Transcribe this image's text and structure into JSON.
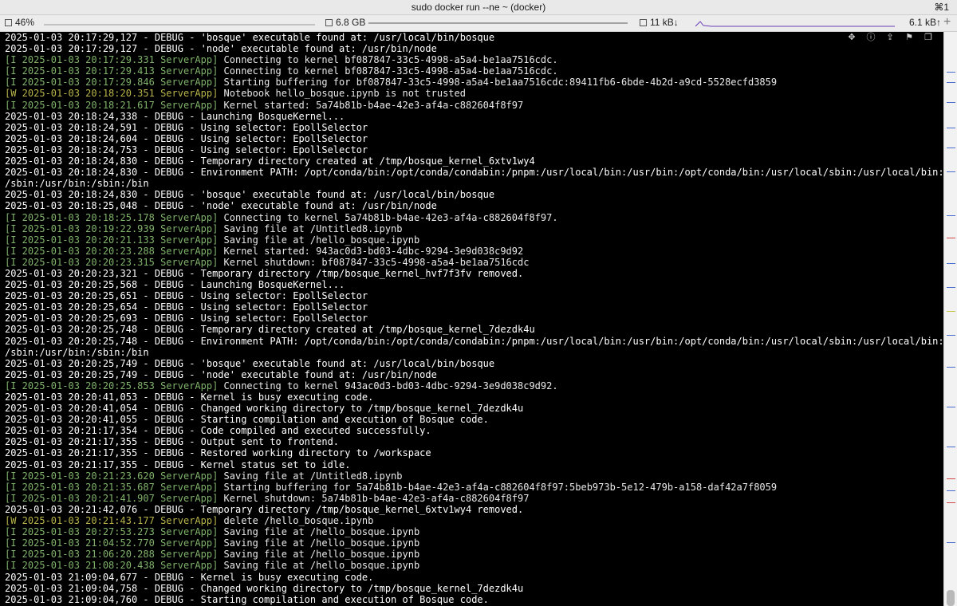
{
  "window": {
    "title": "sudo docker run --ne ~ (docker)",
    "shortcut": "⌘1"
  },
  "statusbar": {
    "cpu": "46%",
    "memory": "6.8 GB",
    "net_down": "11 kB↓",
    "net_up": "6.1 kB↑",
    "plus": "+"
  },
  "toolbar_icons": [
    "move-icon",
    "info-icon",
    "share-icon",
    "bookmark-icon",
    "copy-icon"
  ],
  "log_lines": [
    {
      "type": "debug",
      "text": "2025-01-03 20:17:29,127 - DEBUG - 'bosque' executable found at: /usr/local/bin/bosque"
    },
    {
      "type": "debug",
      "text": "2025-01-03 20:17:29,127 - DEBUG - 'node' executable found at: /usr/bin/node"
    },
    {
      "type": "info",
      "prefix": "[I 2025-01-03 20:17:29.331 ServerApp]",
      "text": " Connecting to kernel bf087847-33c5-4998-a5a4-be1aa7516cdc."
    },
    {
      "type": "info",
      "prefix": "[I 2025-01-03 20:17:29.413 ServerApp]",
      "text": " Connecting to kernel bf087847-33c5-4998-a5a4-be1aa7516cdc."
    },
    {
      "type": "info",
      "prefix": "[I 2025-01-03 20:17:29.846 ServerApp]",
      "text": " Starting buffering for bf087847-33c5-4998-a5a4-be1aa7516cdc:89411fb6-6bde-4b2d-a9cd-5528ecfd3859"
    },
    {
      "type": "warn",
      "prefix": "[W 2025-01-03 20:18:20.351 ServerApp]",
      "text": " Notebook hello_bosque.ipynb is not trusted"
    },
    {
      "type": "info",
      "prefix": "[I 2025-01-03 20:18:21.617 ServerApp]",
      "text": " Kernel started: 5a74b81b-b4ae-42e3-af4a-c882604f8f97"
    },
    {
      "type": "debug",
      "text": "2025-01-03 20:18:24,338 - DEBUG - Launching BosqueKernel..."
    },
    {
      "type": "debug",
      "text": "2025-01-03 20:18:24,591 - DEBUG - Using selector: EpollSelector"
    },
    {
      "type": "debug",
      "text": "2025-01-03 20:18:24,604 - DEBUG - Using selector: EpollSelector"
    },
    {
      "type": "debug",
      "text": "2025-01-03 20:18:24,753 - DEBUG - Using selector: EpollSelector"
    },
    {
      "type": "debug",
      "text": "2025-01-03 20:18:24,830 - DEBUG - Temporary directory created at /tmp/bosque_kernel_6xtv1wy4"
    },
    {
      "type": "debug",
      "text": "2025-01-03 20:18:24,830 - DEBUG - Environment PATH: /opt/conda/bin:/opt/conda/condabin:/pnpm:/usr/local/bin:/usr/bin:/opt/conda/bin:/usr/local/sbin:/usr/local/bin:/usr"
    },
    {
      "type": "debug",
      "text": "/sbin:/usr/bin:/sbin:/bin"
    },
    {
      "type": "debug",
      "text": "2025-01-03 20:18:24,830 - DEBUG - 'bosque' executable found at: /usr/local/bin/bosque"
    },
    {
      "type": "debug",
      "text": "2025-01-03 20:18:25,048 - DEBUG - 'node' executable found at: /usr/bin/node"
    },
    {
      "type": "info",
      "prefix": "[I 2025-01-03 20:18:25.178 ServerApp]",
      "text": " Connecting to kernel 5a74b81b-b4ae-42e3-af4a-c882604f8f97."
    },
    {
      "type": "info",
      "prefix": "[I 2025-01-03 20:19:22.939 ServerApp]",
      "text": " Saving file at /Untitled8.ipynb"
    },
    {
      "type": "info",
      "prefix": "[I 2025-01-03 20:20:21.133 ServerApp]",
      "text": " Saving file at /hello_bosque.ipynb"
    },
    {
      "type": "info",
      "prefix": "[I 2025-01-03 20:20:23.288 ServerApp]",
      "text": " Kernel started: 943ac0d3-bd03-4dbc-9294-3e9d038c9d92"
    },
    {
      "type": "info",
      "prefix": "[I 2025-01-03 20:20:23.315 ServerApp]",
      "text": " Kernel shutdown: bf087847-33c5-4998-a5a4-be1aa7516cdc"
    },
    {
      "type": "debug",
      "text": "2025-01-03 20:20:23,321 - DEBUG - Temporary directory /tmp/bosque_kernel_hvf7f3fv removed."
    },
    {
      "type": "debug",
      "text": "2025-01-03 20:20:25,568 - DEBUG - Launching BosqueKernel..."
    },
    {
      "type": "debug",
      "text": "2025-01-03 20:20:25,651 - DEBUG - Using selector: EpollSelector"
    },
    {
      "type": "debug",
      "text": "2025-01-03 20:20:25,654 - DEBUG - Using selector: EpollSelector"
    },
    {
      "type": "debug",
      "text": "2025-01-03 20:20:25,693 - DEBUG - Using selector: EpollSelector"
    },
    {
      "type": "debug",
      "text": "2025-01-03 20:20:25,748 - DEBUG - Temporary directory created at /tmp/bosque_kernel_7dezdk4u"
    },
    {
      "type": "debug",
      "text": "2025-01-03 20:20:25,748 - DEBUG - Environment PATH: /opt/conda/bin:/opt/conda/condabin:/pnpm:/usr/local/bin:/usr/bin:/opt/conda/bin:/usr/local/sbin:/usr/local/bin:/usr"
    },
    {
      "type": "debug",
      "text": "/sbin:/usr/bin:/sbin:/bin"
    },
    {
      "type": "debug",
      "text": "2025-01-03 20:20:25,749 - DEBUG - 'bosque' executable found at: /usr/local/bin/bosque"
    },
    {
      "type": "debug",
      "text": "2025-01-03 20:20:25,749 - DEBUG - 'node' executable found at: /usr/bin/node"
    },
    {
      "type": "info",
      "prefix": "[I 2025-01-03 20:20:25.853 ServerApp]",
      "text": " Connecting to kernel 943ac0d3-bd03-4dbc-9294-3e9d038c9d92."
    },
    {
      "type": "debug",
      "text": "2025-01-03 20:20:41,053 - DEBUG - Kernel is busy executing code."
    },
    {
      "type": "debug",
      "text": "2025-01-03 20:20:41,054 - DEBUG - Changed working directory to /tmp/bosque_kernel_7dezdk4u"
    },
    {
      "type": "debug",
      "text": "2025-01-03 20:20:41,055 - DEBUG - Starting compilation and execution of Bosque code."
    },
    {
      "type": "debug",
      "text": "2025-01-03 20:21:17,354 - DEBUG - Code compiled and executed successfully."
    },
    {
      "type": "debug",
      "text": "2025-01-03 20:21:17,355 - DEBUG - Output sent to frontend."
    },
    {
      "type": "debug",
      "text": "2025-01-03 20:21:17,355 - DEBUG - Restored working directory to /workspace"
    },
    {
      "type": "debug",
      "text": "2025-01-03 20:21:17,355 - DEBUG - Kernel status set to idle."
    },
    {
      "type": "info",
      "prefix": "[I 2025-01-03 20:21:23.620 ServerApp]",
      "text": " Saving file at /Untitled8.ipynb"
    },
    {
      "type": "info",
      "prefix": "[I 2025-01-03 20:21:35.687 ServerApp]",
      "text": " Starting buffering for 5a74b81b-b4ae-42e3-af4a-c882604f8f97:5beb973b-5e12-479b-a158-daf42a7f8059"
    },
    {
      "type": "info",
      "prefix": "[I 2025-01-03 20:21:41.907 ServerApp]",
      "text": " Kernel shutdown: 5a74b81b-b4ae-42e3-af4a-c882604f8f97"
    },
    {
      "type": "debug",
      "text": "2025-01-03 20:21:42,076 - DEBUG - Temporary directory /tmp/bosque_kernel_6xtv1wy4 removed."
    },
    {
      "type": "warn",
      "prefix": "[W 2025-01-03 20:21:43.177 ServerApp]",
      "text": " delete /hello_bosque.ipynb"
    },
    {
      "type": "info",
      "prefix": "[I 2025-01-03 20:27:53.273 ServerApp]",
      "text": " Saving file at /hello_bosque.ipynb"
    },
    {
      "type": "info",
      "prefix": "[I 2025-01-03 21:04:52.770 ServerApp]",
      "text": " Saving file at /hello_bosque.ipynb"
    },
    {
      "type": "info",
      "prefix": "[I 2025-01-03 21:06:20.288 ServerApp]",
      "text": " Saving file at /hello_bosque.ipynb"
    },
    {
      "type": "info",
      "prefix": "[I 2025-01-03 21:08:20.438 ServerApp]",
      "text": " Saving file at /hello_bosque.ipynb"
    },
    {
      "type": "debug",
      "text": "2025-01-03 21:09:04,677 - DEBUG - Kernel is busy executing code."
    },
    {
      "type": "debug",
      "text": "2025-01-03 21:09:04,758 - DEBUG - Changed working directory to /tmp/bosque_kernel_7dezdk4u"
    },
    {
      "type": "debug",
      "text": "2025-01-03 21:09:04,760 - DEBUG - Starting compilation and execution of Bosque code."
    }
  ],
  "colors": {
    "info": "#7fb26a",
    "warn": "#b7b44a",
    "text": "#e9e9e9",
    "bg": "#000000"
  }
}
